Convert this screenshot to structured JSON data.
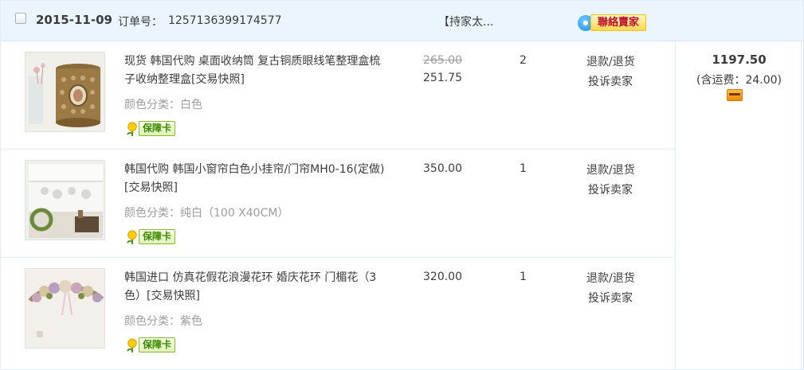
{
  "order": {
    "date": "2015-11-09",
    "order_no_label": "订单号：",
    "order_no": "1257136399174577",
    "shop_name": "【持家太...",
    "contact_label": "聯絡賣家",
    "total": "1197.50",
    "shipping_text": "(含运费：24.00)",
    "icons": {
      "checkbox": "checkbox",
      "contact": "chat-bubble-icon",
      "payment": "payment-card-icon",
      "guarantee": "tulip-icon"
    },
    "colors": {
      "header_bg": "#eaf5fd",
      "contact_text": "#c0102b",
      "badge_text": "#3d8a00"
    }
  },
  "items": [
    {
      "title": "现货 韩国代购 桌面收纳筒 复古铜质眼线笔整理盒梳子收纳整理盒[交易快照]",
      "sku": "颜色分类：白色",
      "badge": "保障卡",
      "price_original": "265.00",
      "price": "251.75",
      "qty": "2",
      "action1": "退款/退货",
      "action2": "投诉卖家"
    },
    {
      "title": "韩国代购 韩国小窗帘白色小挂帘/门帘MH0-16(定做)[交易快照]",
      "sku": "颜色分类：纯白（100 X40CM）",
      "badge": "保障卡",
      "price": "350.00",
      "qty": "1",
      "action1": "退款/退货",
      "action2": "投诉卖家"
    },
    {
      "title": "韩国进口 仿真花假花浪漫花环 婚庆花环 门楣花（3色）[交易快照]",
      "sku": "颜色分类：紫色",
      "badge": "保障卡",
      "price": "320.00",
      "qty": "1",
      "action1": "退款/退货",
      "action2": "投诉卖家"
    }
  ]
}
